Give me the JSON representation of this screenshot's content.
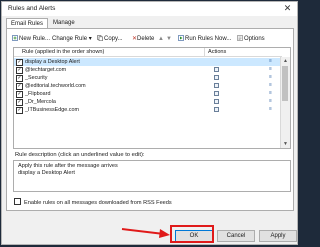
{
  "window": {
    "title": "Rules and Alerts",
    "close_glyph": "✕"
  },
  "tabs": [
    {
      "label": "Email Rules",
      "active": true
    },
    {
      "label": "Manage Alerts",
      "active": false
    }
  ],
  "toolbar": {
    "new_rule": "New Rule...",
    "change_rule": "Change Rule",
    "copy": "Copy...",
    "delete": "Delete",
    "run_rules": "Run Rules Now...",
    "options": "Options"
  },
  "table": {
    "col_rule": "Rule (applied in the order shown)",
    "col_actions": "Actions",
    "rows": [
      {
        "name": "display a Desktop Alert",
        "checked": true,
        "selected": true
      },
      {
        "name": "@techtarget.com",
        "checked": true,
        "selected": false
      },
      {
        "name": "_Security",
        "checked": true,
        "selected": false
      },
      {
        "name": "@editorial.techworld.com",
        "checked": true,
        "selected": false
      },
      {
        "name": "_Flipboard",
        "checked": true,
        "selected": false
      },
      {
        "name": "_Dr_Mercola",
        "checked": true,
        "selected": false
      },
      {
        "name": "_ITBusinessEdge.com",
        "checked": true,
        "selected": false
      }
    ]
  },
  "description": {
    "label": "Rule description (click an underlined value to edit):",
    "line1": "Apply this rule after the message arrives",
    "line2": "display a Desktop Alert"
  },
  "rss": {
    "label": "Enable rules on all messages downloaded from RSS Feeds",
    "checked": false
  },
  "buttons": {
    "ok": "OK",
    "cancel": "Cancel",
    "apply": "Apply"
  },
  "colors": {
    "highlight": "#e01a1a",
    "selection": "#cce8ff",
    "accent": "#0078d7"
  }
}
